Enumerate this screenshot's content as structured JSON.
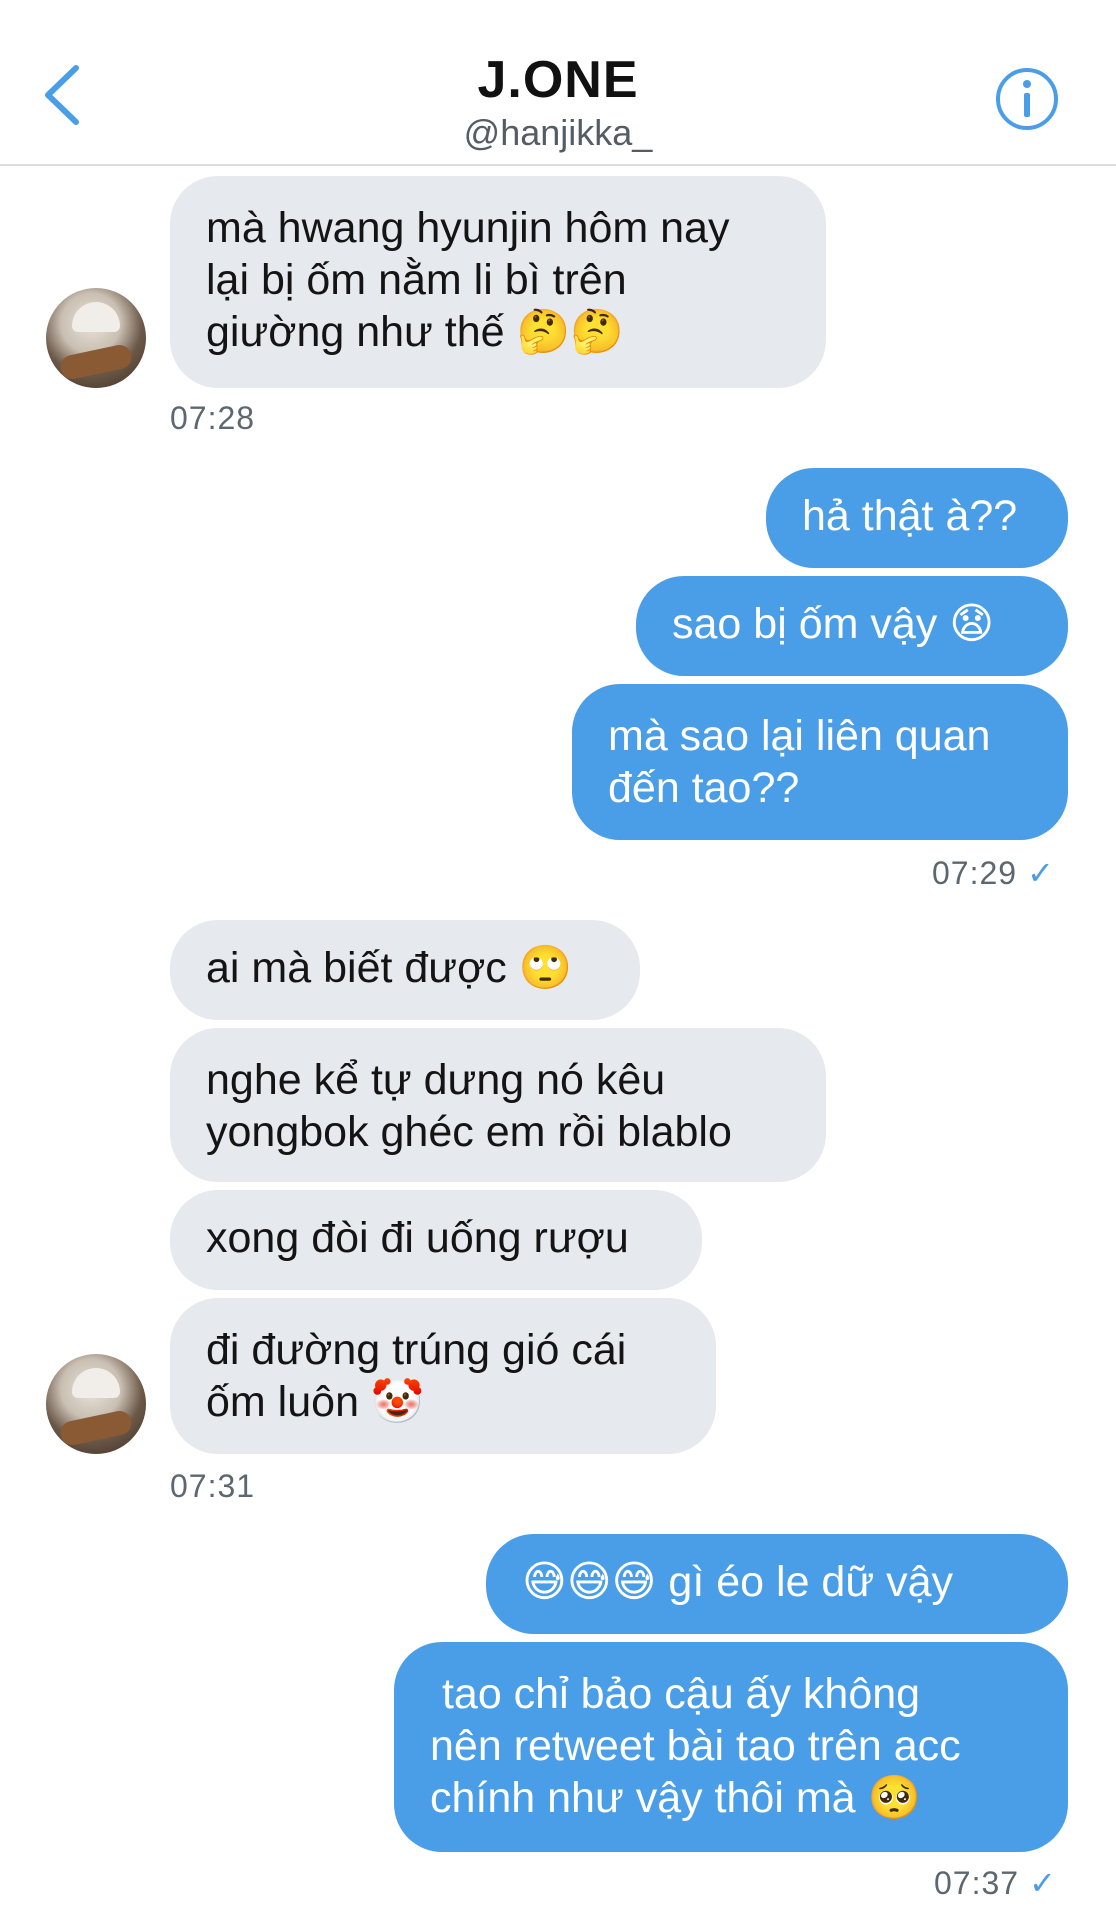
{
  "header": {
    "title": "J.ONE",
    "handle": "@hanjikka_"
  },
  "messages": [
    {
      "text": "mà hwang hyunjin hôm nay\nlại bị ốm nằm li bì trên\ngiường như thế 🤔🤔"
    },
    {
      "text": "hả thật à??"
    },
    {
      "text": "sao bị ốm vậy 😧"
    },
    {
      "text": "mà sao lại liên quan\nđến tao??"
    },
    {
      "text": "ai mà biết được 🙄"
    },
    {
      "text": "nghe kể tự dưng nó kêu\nyongbok ghéc em rồi blablo"
    },
    {
      "text": "xong đòi đi uống rượu"
    },
    {
      "text": "đi đường trúng gió cái\nốm luôn 🤡"
    },
    {
      "text": "😅😅😅 gì éo le dữ vậy"
    },
    {
      "text": " tao chỉ bảo cậu ấy không\nnên retweet bài tao trên acc\nchính như vậy thôi mà 🥺"
    }
  ],
  "timestamps": [
    "07:28",
    "07:29",
    "07:31",
    "07:37"
  ],
  "read_check": "✓",
  "colors": {
    "outgoing_bubble": "#4a9ee8",
    "incoming_bubble": "#e6e9ee",
    "accent": "#4a9ee8"
  },
  "icons": [
    "back-chevron-icon",
    "info-icon",
    "read-check-icon"
  ]
}
